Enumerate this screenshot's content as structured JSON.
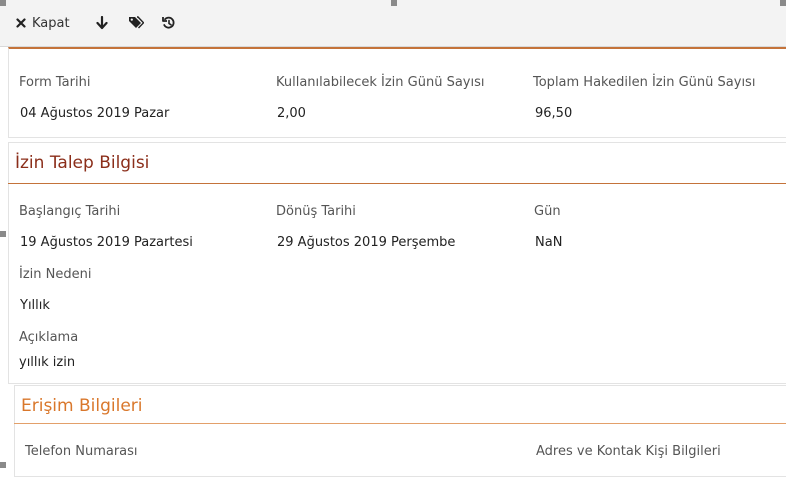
{
  "toolbar": {
    "close_label": "Kapat",
    "icons": [
      "close-icon",
      "arrow-down-icon",
      "tags-icon",
      "history-icon"
    ]
  },
  "form_info": {
    "fields": [
      {
        "label": "Form Tarihi",
        "value": "04 Ağustos 2019 Pazar"
      },
      {
        "label": "Kullanılabilecek İzin Günü Sayısı",
        "value": "2,00"
      },
      {
        "label": "Toplam Hakedilen İzin Günü Sayısı",
        "value": "96,50"
      }
    ]
  },
  "izin_talep": {
    "title": "İzin Talep Bilgisi",
    "start": {
      "label": "Başlangıç Tarihi",
      "value": "19 Ağustos 2019 Pazartesi"
    },
    "return": {
      "label": "Dönüş Tarihi",
      "value": "29 Ağustos 2019 Perşembe"
    },
    "days": {
      "label": "Gün",
      "value": "NaN"
    },
    "reason": {
      "label": "İzin Nedeni",
      "value": "Yıllık"
    },
    "description": {
      "label": "Açıklama",
      "value": "yıllık izin"
    }
  },
  "erisim": {
    "title": "Erişim Bilgileri",
    "phone_label": "Telefon Numarası",
    "address_label": "Adres ve Kontak Kişi Bilgileri"
  },
  "colors": {
    "accent": "#c4733a",
    "section_title": "#8b2e1a",
    "erisim_title": "#d9772b",
    "toolbar_bg": "#f3f3f3"
  }
}
